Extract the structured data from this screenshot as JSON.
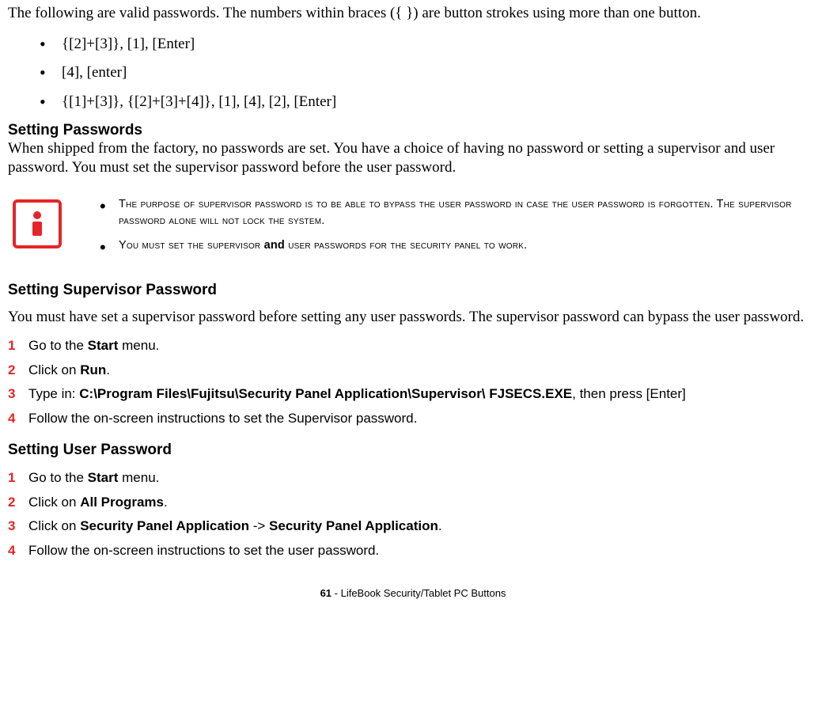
{
  "intro": "The following are valid passwords. The numbers within braces ({ }) are button strokes using more than one button.",
  "passwords": {
    "item1": "{[2]+[3]}, [1], [Enter]",
    "item2": "[4], [enter]",
    "item3": "{[1]+[3]}, {[2]+[3]+[4]}, [1], [4], [2], [Enter]"
  },
  "setting_passwords": {
    "heading": "Setting Passwords",
    "body": "When shipped from the factory, no passwords are set. You have a choice of having no password or setting a supervisor and user password. You must set the supervisor password before the user password."
  },
  "info_note": {
    "line1a": "The purpose of supervisor password is to be able to bypass the user password in case the user password is forgotten. The supervisor password alone will not lock the system.",
    "line2a": "You must set the supervisor ",
    "line2b": "and",
    "line2c": " user passwords for the security panel to work."
  },
  "supervisor": {
    "heading": "Setting Supervisor Password",
    "body": "You must have set a supervisor password before setting any user passwords. The supervisor password can bypass the user password.",
    "steps": {
      "n1": "1",
      "s1a": "Go to the ",
      "s1b": "Start",
      "s1c": " menu.",
      "n2": "2",
      "s2a": "Click on ",
      "s2b": "Run",
      "s2c": ".",
      "n3": "3",
      "s3a": "Type in: ",
      "s3b": "C:\\Program Files\\Fujitsu\\Security Panel Application\\Supervisor\\ FJSECS.EXE",
      "s3c": ", then press [Enter]",
      "n4": "4",
      "s4a": "Follow the on-screen instructions to set the Supervisor password."
    }
  },
  "user": {
    "heading": "Setting User Password",
    "steps": {
      "n1": "1",
      "s1a": "Go to the ",
      "s1b": "Start",
      "s1c": " menu.",
      "n2": "2",
      "s2a": "Click on ",
      "s2b": "All Programs",
      "s2c": ".",
      "n3": "3",
      "s3a": "Click on ",
      "s3b": "Security Panel Application",
      "s3c": " -> ",
      "s3d": "Security Panel Application",
      "s3e": ".",
      "n4": "4",
      "s4a": "Follow the on-screen instructions to set the user password."
    }
  },
  "footer": {
    "page": "61",
    "sep": " - ",
    "title": "LifeBook Security/Tablet PC Buttons"
  }
}
